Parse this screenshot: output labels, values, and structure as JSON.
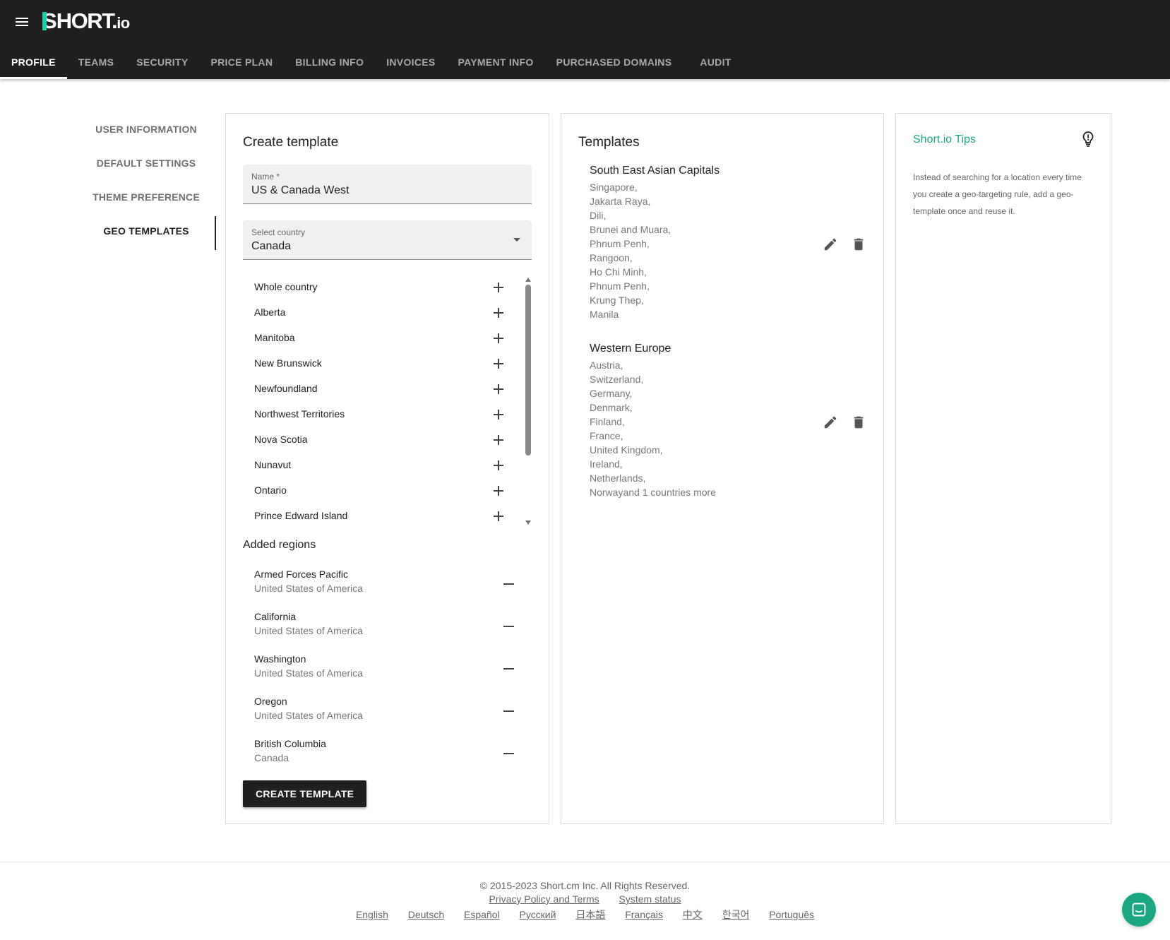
{
  "header": {
    "logo_main": "HORT.",
    "logo_s": "S",
    "logo_io": "io",
    "tabs": [
      {
        "label": "PROFILE",
        "active": true
      },
      {
        "label": "TEAMS"
      },
      {
        "label": "SECURITY"
      },
      {
        "label": "PRICE PLAN"
      },
      {
        "label": "BILLING INFO"
      },
      {
        "label": "INVOICES"
      },
      {
        "label": "PAYMENT INFO"
      },
      {
        "label": "PURCHASED DOMAINS"
      },
      {
        "label": "AUDIT"
      }
    ]
  },
  "subnav": {
    "items": [
      {
        "label": "USER INFORMATION"
      },
      {
        "label": "DEFAULT SETTINGS"
      },
      {
        "label": "THEME PREFERENCE"
      },
      {
        "label": "GEO TEMPLATES",
        "active": true
      }
    ]
  },
  "create": {
    "title": "Create template",
    "name_label": "Name *",
    "name_value": "US & Canada West",
    "country_label": "Select country",
    "country_value": "Canada",
    "regions": [
      "Whole country",
      "Alberta",
      "Manitoba",
      "New Brunswick",
      "Newfoundland",
      "Northwest Territories",
      "Nova Scotia",
      "Nunavut",
      "Ontario",
      "Prince Edward Island"
    ],
    "added_title": "Added regions",
    "added": [
      {
        "name": "Armed Forces Pacific",
        "country": "United States of America"
      },
      {
        "name": "California",
        "country": "United States of America"
      },
      {
        "name": "Washington",
        "country": "United States of America"
      },
      {
        "name": "Oregon",
        "country": "United States of America"
      },
      {
        "name": "British Columbia",
        "country": "Canada"
      }
    ],
    "button_label": "CREATE TEMPLATE"
  },
  "templates": {
    "title": "Templates",
    "items": [
      {
        "name": "South East Asian Capitals",
        "lines": [
          "Singapore,",
          "Jakarta Raya,",
          "Dili,",
          "Brunei and Muara,",
          "Phnum Penh,",
          "Rangoon,",
          "Ho Chi Minh,",
          "Phnum Penh,",
          "Krung Thep,",
          "Manila"
        ]
      },
      {
        "name": "Western Europe",
        "lines": [
          "Austria,",
          "Switzerland,",
          "Germany,",
          "Denmark,",
          "Finland,",
          "France,",
          "United Kingdom,",
          "Ireland,",
          "Netherlands,",
          "Norwayand 1 countries more"
        ]
      }
    ]
  },
  "tips": {
    "title": "Short.io Tips",
    "text": "Instead of searching for a location every time you create a geo-targeting rule, add a geo-template once and reuse it."
  },
  "footer": {
    "copyright": "© 2015-2023  Short.cm Inc. All Rights Reserved.",
    "links": [
      "Privacy Policy and Terms",
      "System status"
    ],
    "languages": [
      "English",
      "Deutsch",
      "Español",
      "Русский",
      "日本語",
      "Français",
      "中文",
      "한국어",
      "Português"
    ]
  },
  "colors": {
    "header_bg": "#1f1f1f",
    "accent": "#1ad1a5",
    "tips_title": "#1aa883"
  }
}
